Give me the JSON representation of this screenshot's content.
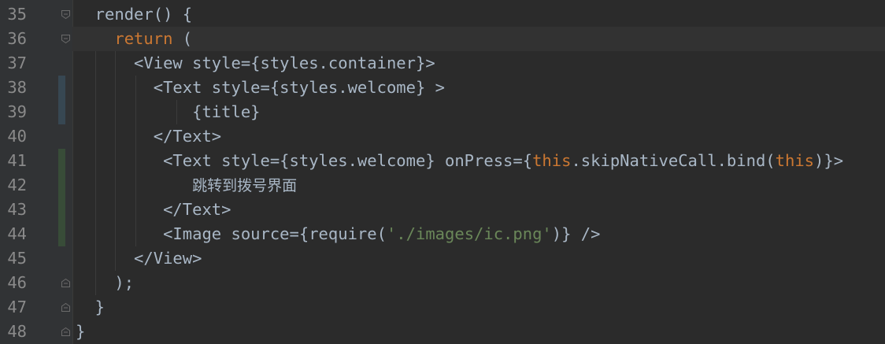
{
  "editor": {
    "lines": [
      {
        "num": "35",
        "parts": [
          {
            "t": "  render() {",
            "c": "plain"
          }
        ],
        "vcs": "none",
        "fold": "open-top"
      },
      {
        "num": "36",
        "parts": [
          {
            "t": "    ",
            "c": "plain"
          },
          {
            "t": "return",
            "c": "kw"
          },
          {
            "t": " (",
            "c": "plain"
          }
        ],
        "vcs": "none",
        "fold": "open-top",
        "current": true
      },
      {
        "num": "37",
        "parts": [
          {
            "t": "      <View style={styles.container}>",
            "c": "plain"
          }
        ],
        "vcs": "none",
        "fold": "none"
      },
      {
        "num": "38",
        "parts": [
          {
            "t": "        <Text style={styles.welcome} >",
            "c": "plain"
          }
        ],
        "vcs": "modified",
        "fold": "none"
      },
      {
        "num": "39",
        "parts": [
          {
            "t": "            {title}",
            "c": "plain"
          }
        ],
        "vcs": "modified",
        "fold": "none"
      },
      {
        "num": "40",
        "parts": [
          {
            "t": "        </Text>",
            "c": "plain"
          }
        ],
        "vcs": "none",
        "fold": "none"
      },
      {
        "num": "41",
        "parts": [
          {
            "t": "         <Text style={styles.welcome} onPress={",
            "c": "plain"
          },
          {
            "t": "this",
            "c": "kw"
          },
          {
            "t": ".skipNativeCall.bind(",
            "c": "plain"
          },
          {
            "t": "this",
            "c": "kw"
          },
          {
            "t": ")}>",
            "c": "plain"
          }
        ],
        "vcs": "added",
        "fold": "none"
      },
      {
        "num": "42",
        "parts": [
          {
            "t": "            ",
            "c": "plain"
          },
          {
            "t": "跳转到拨号界面",
            "c": "cjk"
          }
        ],
        "vcs": "added",
        "fold": "none"
      },
      {
        "num": "43",
        "parts": [
          {
            "t": "         </Text>",
            "c": "plain"
          }
        ],
        "vcs": "added",
        "fold": "none"
      },
      {
        "num": "44",
        "parts": [
          {
            "t": "         <Image source={require(",
            "c": "plain"
          },
          {
            "t": "'./images/ic.png'",
            "c": "str"
          },
          {
            "t": ")} />",
            "c": "plain"
          }
        ],
        "vcs": "added",
        "fold": "none"
      },
      {
        "num": "45",
        "parts": [
          {
            "t": "      </View>",
            "c": "plain"
          }
        ],
        "vcs": "none",
        "fold": "none"
      },
      {
        "num": "46",
        "parts": [
          {
            "t": "    );",
            "c": "plain"
          }
        ],
        "vcs": "none",
        "fold": "close-bottom"
      },
      {
        "num": "47",
        "parts": [
          {
            "t": "  }",
            "c": "plain"
          }
        ],
        "vcs": "none",
        "fold": "close-bottom"
      },
      {
        "num": "48",
        "parts": [
          {
            "t": "}",
            "c": "plain"
          }
        ],
        "vcs": "none",
        "fold": "close-bottom"
      }
    ]
  },
  "colors": {
    "background": "#2b2b2b",
    "gutter": "#313335",
    "current_line": "#323232",
    "text": "#a9b7c6",
    "keyword": "#cc7832",
    "string": "#6a8759",
    "line_number": "#8a8a8a",
    "vcs_modified": "#374752",
    "vcs_added": "#384c38"
  }
}
